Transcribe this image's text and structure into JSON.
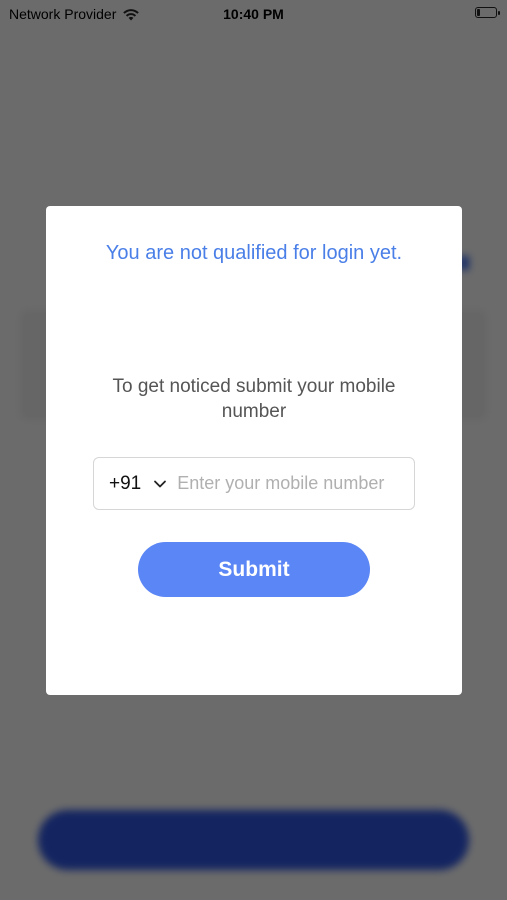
{
  "status_bar": {
    "carrier": "Network Provider",
    "time": "10:40 PM",
    "wifi_icon": "wifi-icon",
    "battery_icon": "battery-icon",
    "battery_level": 0.15
  },
  "modal": {
    "title": "You are not qualified for login yet.",
    "description": "To get noticed submit your mobile number",
    "country_code": "+91",
    "country_chevron_icon": "chevron-down-icon",
    "mobile_placeholder": "Enter your mobile number",
    "mobile_value": "",
    "submit_label": "Submit"
  },
  "colors": {
    "accent": "#5b86f5",
    "title_blue": "#4a7fe8",
    "overlay": "rgba(0,0,0,0.58)"
  }
}
